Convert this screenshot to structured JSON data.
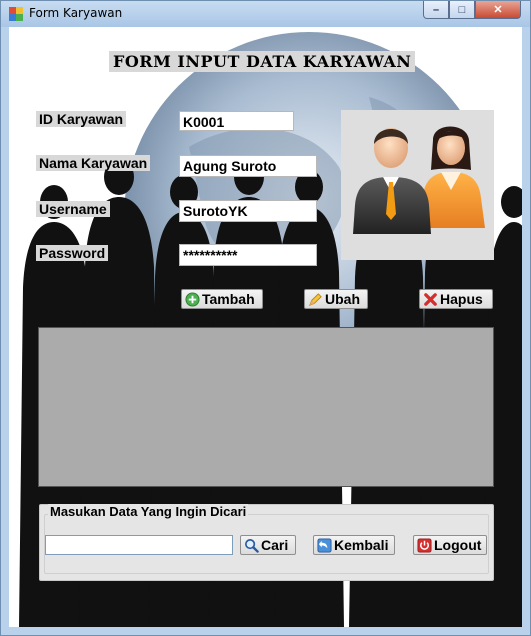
{
  "window": {
    "title": "Form Karyawan",
    "controls": {
      "minimize": "–",
      "maximize": "□",
      "close": "✕"
    }
  },
  "form": {
    "heading": "FORM INPUT DATA KARYAWAN",
    "fields": [
      {
        "label": "ID Karyawan",
        "value": "K0001"
      },
      {
        "label": "Nama Karyawan",
        "value": "Agung Suroto"
      },
      {
        "label": "Username",
        "value": "SurotoYK"
      },
      {
        "label": "Password",
        "value": "**********"
      }
    ],
    "buttons": {
      "add": "Tambah",
      "edit": "Ubah",
      "delete": "Hapus"
    }
  },
  "search": {
    "group_title": "Masukan Data Yang Ingin Dicari",
    "input_value": "",
    "buttons": {
      "find": "Cari",
      "back": "Kembali",
      "logout": "Logout"
    }
  },
  "icons": {
    "app": "app-form-icon",
    "photo": "users-icon",
    "add": "plus-circle-icon",
    "edit": "pencil-icon",
    "delete": "x-icon",
    "find": "magnifier-icon",
    "back": "back-icon",
    "logout": "power-icon"
  },
  "colors": {
    "titlebar": "#b9d1ea",
    "label_bg": "#d8d8d8",
    "grid_bg": "#ababab",
    "close_button": "#c84a32"
  }
}
